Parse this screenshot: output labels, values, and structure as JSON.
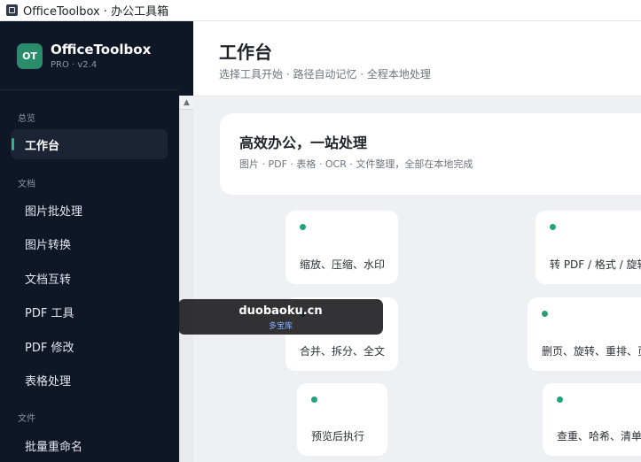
{
  "window": {
    "title": "OfficeToolbox · 办公工具箱"
  },
  "brand": {
    "logo_text": "OT",
    "name": "OfficeToolbox",
    "version": "PRO · v2.4"
  },
  "sidebar": {
    "sections": [
      {
        "label": "总览",
        "items": [
          "工作台"
        ]
      },
      {
        "label": "文档",
        "items": [
          "图片批处理",
          "图片转换",
          "文档互转",
          "PDF 工具",
          "PDF 修改",
          "表格处理"
        ]
      },
      {
        "label": "文件",
        "items": [
          "批量重命名"
        ]
      }
    ],
    "active_item": "工作台"
  },
  "scrollbar": {
    "up_arrow": "▲"
  },
  "header": {
    "title": "工作台",
    "subtitle": "选择工具开始 · 路径自动记忆 · 全程本地处理"
  },
  "hero": {
    "title": "高效办公，一站处理",
    "subtitle": "图片 · PDF · 表格 · OCR · 文件整理，全部在本地完成"
  },
  "cards": [
    {
      "label": "缩放、压缩、水印"
    },
    {
      "label": "转 PDF / 格式 / 旋转"
    },
    {
      "label": "合并、拆分、全文"
    },
    {
      "label": "删页、旋转、重排、页"
    },
    {
      "label": "预览后执行"
    },
    {
      "label": "查重、哈希、清单"
    }
  ],
  "watermark": {
    "main": "duobaoku.cn",
    "sub": "多宝库"
  },
  "colors": {
    "sidebar_bg": "#0f1626",
    "accent": "#23a27b",
    "logo_bg": "#2a8c6a"
  }
}
